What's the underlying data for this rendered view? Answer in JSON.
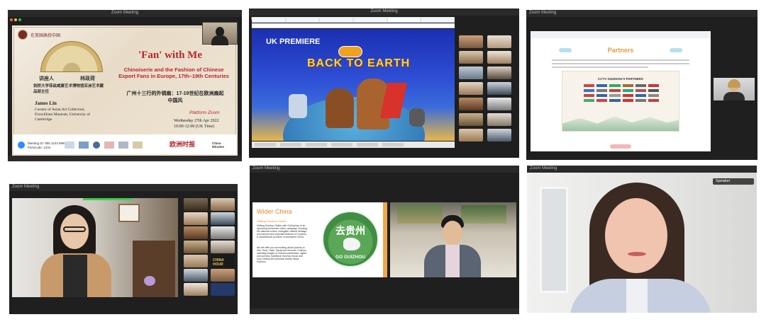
{
  "tile1": {
    "window_title": "Zoom Meeting",
    "lecture_title": "'Fan' with Me",
    "subtitle": "Chinoiserie and the Fashion of Chinese Export Fans in Europe, 17th–19th Centuries",
    "chinese_title": "广州十三行的外销扇：17-19世纪在欧洲扇起中国风",
    "speaker_label_cn": "讲座人",
    "speaker_name_cn": "林政荷",
    "speaker_desc_cn": "剑桥大学菲兹威廉艺术博物馆亚洲艺术藏品部主任",
    "speaker_name": "James Lin",
    "speaker_role": "Curator of Asian Art Collection, Fitzwilliam Museum, University of Cambridge",
    "platform": "Platform Zoom",
    "date": "Wednesday 27th Apr 2022",
    "time": "10:00-12:00 (UK Time)",
    "meeting_id": "Meeting ID: 885 1103 9860",
    "passcode": "Passcode: 1234",
    "org_cn": "在英国高校中国",
    "news_cn": "欧洲时报",
    "china_minutes": "China Minutes"
  },
  "tile2": {
    "window_title": "Zoom Meeting",
    "premiere": "UK PREMIERE",
    "movie": "BACK TO EARTH"
  },
  "tile3": {
    "window_title": "Zoom Meeting",
    "heading": "Partners",
    "card_title": "CCTV GUIZHOU'S PARTNERS"
  },
  "tile4": {
    "window_title": "Zoom Meeting",
    "china_hour": "CHINA HOUR"
  },
  "tile5": {
    "window_title": "Zoom Meeting",
    "slide_heading": "Wider China",
    "slide_sub": "Visiting Guizhou Online",
    "slide_body1": "Visiting Guizhou Online with GoGuizhou is an upcoming immersive online campaign, showing the national culture, intangible cultural heritage, eco-tourism and important features of Guizhou, a mountainous province in southwest China.",
    "slide_body2": "We will offer you an exciting virtual journey to See, Hear, Taste, Study and Discover Guizhou, including images of Guizhou landmarks, sights, and scenery, traditional Guizhou music and food, history and personal stories about Guizhou.",
    "logo_cn": "去贵州",
    "logo_en": "GO GUIZHOU"
  },
  "tile6": {
    "window_title": "Zoom Meeting",
    "name_tag": "Speaker"
  },
  "colors": {
    "zoom_dark": "#1f1f1f",
    "fan_red": "#b8262b",
    "movie_blue": "#2a44c4",
    "partners_orange": "#e99a3a",
    "guizhou_green": "#2f8a43",
    "wider_china_orange": "#e8892f"
  }
}
